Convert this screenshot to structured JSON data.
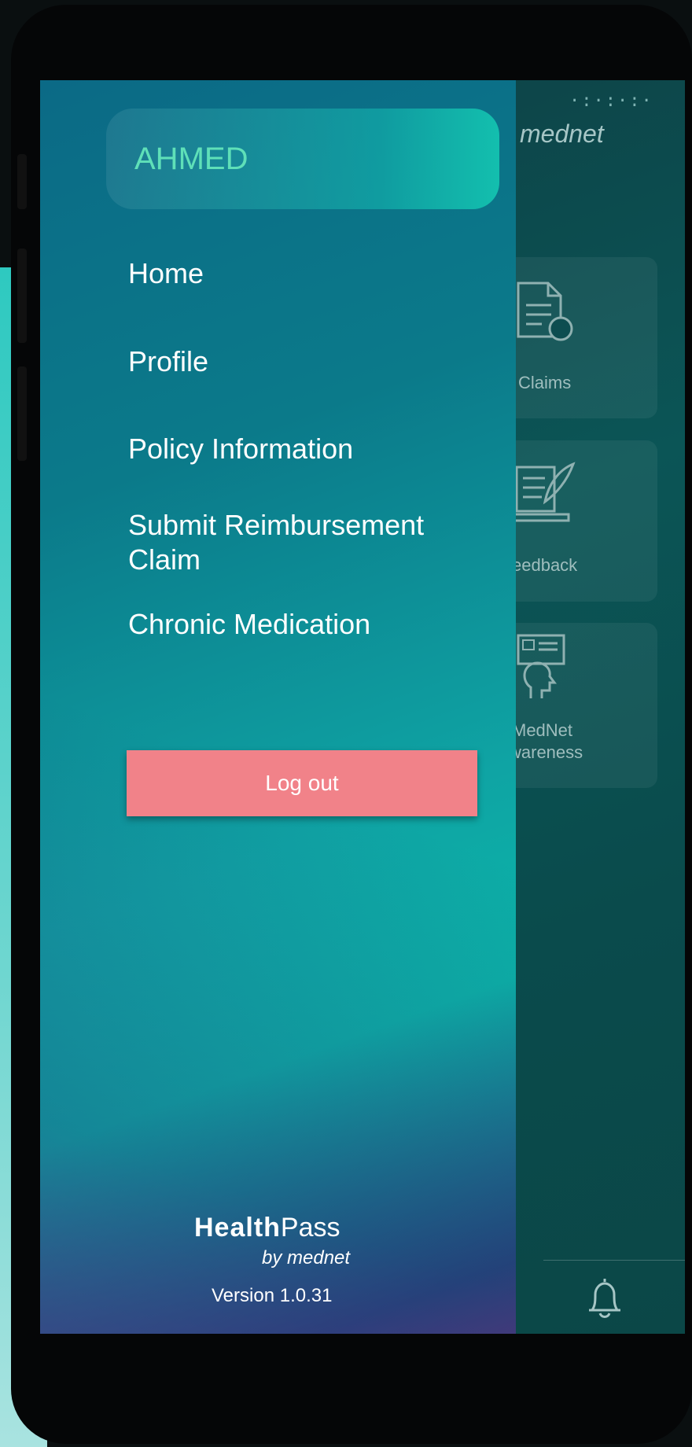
{
  "drawer": {
    "user_name": "AHMED",
    "menu": [
      {
        "label": "Home"
      },
      {
        "label": "Profile"
      },
      {
        "label": "Policy Information"
      },
      {
        "label": "Submit Reimbursement Claim"
      },
      {
        "label": "Chronic Medication"
      }
    ],
    "logout_label": "Log out",
    "brand_health": "Health",
    "brand_pass": "Pass",
    "brand_by": "by mednet",
    "version": "Version 1.0.31"
  },
  "background_app": {
    "logo": "mednet",
    "tiles": [
      {
        "label": "Claims",
        "icon": "claims-document-icon"
      },
      {
        "label": "eedback",
        "icon": "feedback-quill-icon"
      },
      {
        "label": "MedNet",
        "icon": "awareness-head-icon"
      },
      {
        "label": "wareness",
        "icon": ""
      }
    ],
    "bottom_icon": "bell-icon"
  },
  "colors": {
    "drawer_top": "#0b6a86",
    "drawer_mid": "#0fa4a4",
    "drawer_bottom": "#4a3f7a",
    "user_name": "#5fe0b8",
    "logout_button": "#f18289"
  }
}
